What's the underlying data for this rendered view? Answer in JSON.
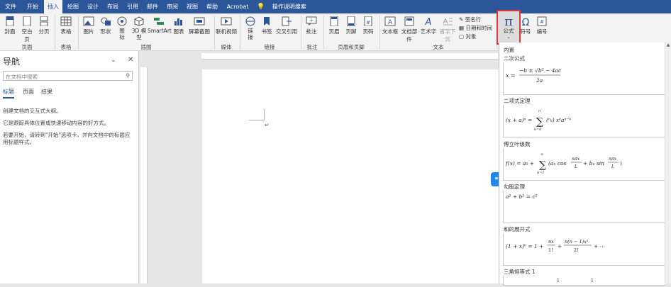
{
  "tabs": [
    "文件",
    "开始",
    "插入",
    "绘图",
    "设计",
    "布局",
    "引用",
    "邮件",
    "审阅",
    "视图",
    "帮助",
    "Acrobat"
  ],
  "active_tab": "插入",
  "tell_me": "操作说明搜索",
  "ribbon": {
    "pages": {
      "cover": "封面",
      "blank": "空白页",
      "break": "分页",
      "group": "页面"
    },
    "table": {
      "label": "表格",
      "group": "表格"
    },
    "illus": {
      "picture": "图片",
      "shapes": "形状",
      "icons": "图标",
      "model3d": "3D 模型",
      "smartart": "SmartArt",
      "chart": "图表",
      "screenshot": "屏幕截图",
      "group": "插图"
    },
    "media": {
      "video": "联机视频",
      "group": "媒体"
    },
    "links": {
      "link": "链接",
      "bookmark": "书签",
      "crossref": "交叉引用",
      "group": "链接"
    },
    "comments": {
      "comment": "批注",
      "group": "批注"
    },
    "hf": {
      "header": "页眉",
      "footer": "页脚",
      "pagenum": "页码",
      "group": "页眉和页脚"
    },
    "text": {
      "textbox": "文本框",
      "parts": "文档部件",
      "wordart": "艺术字",
      "dropcap": "首字下沉",
      "signature": "签名行",
      "datetime": "日期和时间",
      "object": "对象",
      "group": "文本"
    },
    "symbols": {
      "equation": "公式",
      "symbol": "符号",
      "number": "编号"
    }
  },
  "nav": {
    "title": "导航",
    "search_placeholder": "在文档中搜索",
    "tabs": [
      "标题",
      "页面",
      "结果"
    ],
    "text1": "创建文档的交互式大纲。",
    "text2": "它是跟踪具体位置或快速移动内容的好方式。",
    "text3": "若要开始，请转到\"开始\"选项卡，并向文档中的标题应用标题样式。"
  },
  "gallery": {
    "header": "内置",
    "items": [
      {
        "name": "二次公式",
        "formula": "x = (−b ± √(b² − 4ac)) / 2a"
      },
      {
        "name": "二项式定理",
        "formula": "(x + a)ⁿ = Σₖ₌₀ⁿ (ⁿₖ) xᵏaⁿ⁻ᵏ"
      },
      {
        "name": "傅立叶级数",
        "formula": "f(x) = a₀ + Σₙ₌₁^∞ (aₙ cos nπx/L + bₙ sin nπx/L)"
      },
      {
        "name": "勾股定理",
        "formula": "a² + b² = c²"
      },
      {
        "name": "和的展开式",
        "formula": "(1 + x)ⁿ = 1 + nx/1! + n(n − 1)x²/2! + ⋯"
      },
      {
        "name": "三角恒等式 1",
        "formula": ""
      }
    ]
  }
}
